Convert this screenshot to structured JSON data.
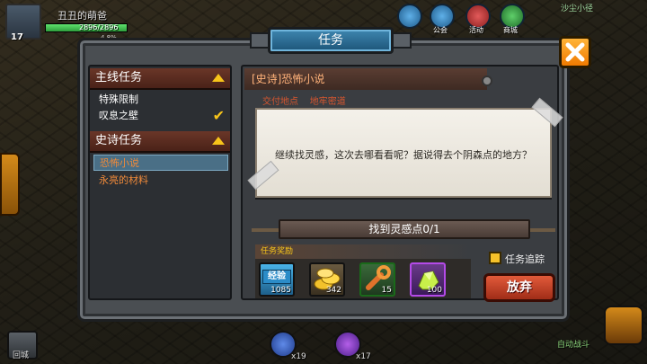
{
  "hud": {
    "player_name": "丑丑的萌爸",
    "level": "17",
    "hp_text": "2896/2896",
    "hp_fraction": 1.0,
    "exp_text": "4.8%",
    "top_buttons": [
      {
        "label": "",
        "icon": "map-icon"
      },
      {
        "label": "公会",
        "icon": "guild-icon"
      },
      {
        "label": "活动",
        "icon": "event-icon"
      },
      {
        "label": "商城",
        "icon": "shop-icon"
      }
    ],
    "minimap_label": "沙尘小径",
    "bottom_left_label": "回城",
    "bottom_counts": [
      "x19",
      "x17"
    ],
    "bottom_right_label": "自动战斗"
  },
  "window": {
    "title": "任务",
    "close_icon": "close-x-icon"
  },
  "categories": [
    {
      "label": "主线任务",
      "items": [
        {
          "label": "特殊限制",
          "color": "#ffffff",
          "completed": false,
          "selected": false
        },
        {
          "label": "叹息之壁",
          "color": "#ffffff",
          "completed": true,
          "selected": false
        }
      ]
    },
    {
      "label": "史诗任务",
      "items": [
        {
          "label": "恐怖小说",
          "color": "#f08a3a",
          "completed": false,
          "selected": true
        },
        {
          "label": "永亮的材料",
          "color": "#f08a3a",
          "completed": false,
          "selected": false
        }
      ]
    }
  ],
  "quest": {
    "title": "[史诗]恐怖小说",
    "location_label": "交付地点",
    "location_value": "地牢密道",
    "description": "继续找灵感，这次去哪看看呢？据说得去个阴森点的地方？",
    "objective": "找到灵感点0/1",
    "reward_label": "任务奖励",
    "rewards": [
      {
        "name": "经验",
        "count": "1085",
        "icon": "exp-icon",
        "color": "#2b8cc8"
      },
      {
        "name": "",
        "count": "342",
        "icon": "gold-coins-icon",
        "color": "#f2c12b"
      },
      {
        "name": "",
        "count": "15",
        "icon": "wrench-icon",
        "color": "#e0722b"
      },
      {
        "name": "",
        "count": "100",
        "icon": "gem-ore-icon",
        "color": "#c8f04a"
      }
    ],
    "track_label": "任务追踪",
    "track_checked": true,
    "abandon_label": "放弃"
  },
  "colors": {
    "accent": "#f7c41a",
    "title_bg": "#2a6a92",
    "close_bg": "#f29a1a",
    "abandon_bg": "#c2401f",
    "location_text": "#d7562f"
  }
}
